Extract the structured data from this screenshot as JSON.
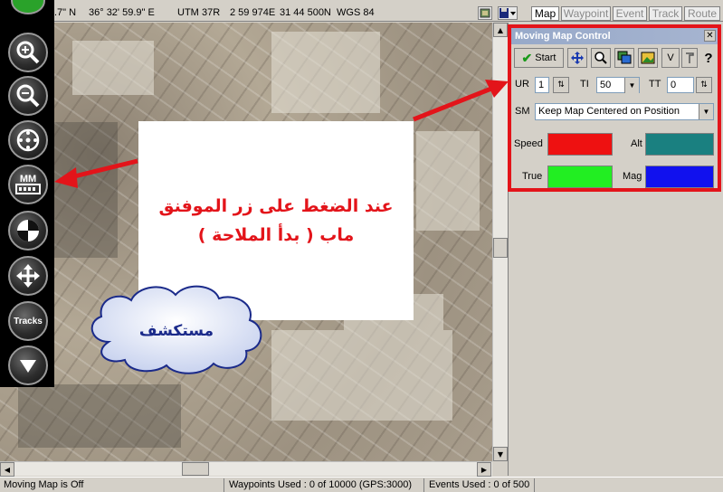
{
  "coordinates": {
    "lat_fragment": ".7\" N",
    "lon": "36° 32' 59.9\" E",
    "utm_label": "UTM",
    "utm_zone": "37R",
    "easting": "2 59 974E",
    "northing": "31 44 500N",
    "datum": "WGS 84"
  },
  "tabs": [
    {
      "label": "Map",
      "active": true
    },
    {
      "label": "Waypoint",
      "active": false
    },
    {
      "label": "Event",
      "active": false
    },
    {
      "label": "Track",
      "active": false
    },
    {
      "label": "Route",
      "active": false
    }
  ],
  "toolbar_icons": [
    "map-options-icon",
    "save-dropdown-icon"
  ],
  "left_toolbar": {
    "buttons": [
      {
        "name": "zoom-in",
        "icon": "zoom-in-icon"
      },
      {
        "name": "zoom-out",
        "icon": "zoom-out-icon"
      },
      {
        "name": "gps-center",
        "icon": "crosshair-icon"
      },
      {
        "name": "moving-map",
        "icon": "mm-icon",
        "label": "MM"
      },
      {
        "name": "navigate",
        "icon": "compass-quadrant-icon"
      },
      {
        "name": "pan",
        "icon": "move-arrows-icon"
      },
      {
        "name": "tracks",
        "icon": "tracks-icon",
        "label": "Tracks"
      },
      {
        "name": "scroll-down",
        "icon": "down-arrow-icon"
      }
    ]
  },
  "moving_map_control": {
    "title": "Moving Map Control",
    "start_label": "Start",
    "v_label": "V",
    "ur_label": "UR",
    "ur_value": "1",
    "ti_label": "TI",
    "ti_value": "50",
    "tt_label": "TT",
    "tt_value": "0",
    "sm_label": "SM",
    "sm_value": "Keep Map Centered on Position",
    "speed_label": "Speed",
    "alt_label": "Alt",
    "true_label": "True",
    "mag_label": "Mag",
    "colors": {
      "speed": "#ee1111",
      "alt": "#1a8080",
      "true": "#22ee22",
      "mag": "#1111ee"
    }
  },
  "annotation": {
    "line1": "عند الضغط على زر الموفنق",
    "line2": "ماب ( بدأ الملاحة )"
  },
  "cloud_label": "مستكشف",
  "status": {
    "moving_map": "Moving Map is Off",
    "waypoints": "Waypoints Used : 0 of 10000  (GPS:3000)",
    "events": "Events Used : 0 of 500"
  },
  "accent_color": "#e3141a"
}
